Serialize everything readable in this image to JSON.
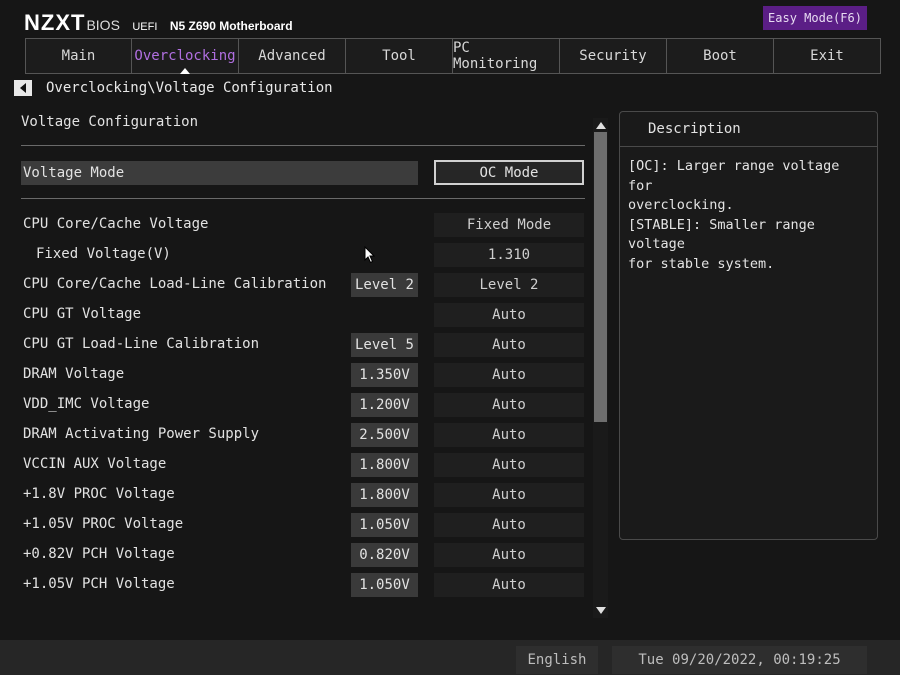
{
  "brand": {
    "logo": "NZXT",
    "bios": "BIOS",
    "uefi": "UEFI",
    "model": "N5 Z690 Motherboard"
  },
  "easy_mode_label": "Easy Mode(F6)",
  "tabs": [
    {
      "label": "Main"
    },
    {
      "label": "Overclocking"
    },
    {
      "label": "Advanced"
    },
    {
      "label": "Tool"
    },
    {
      "label": "PC Monitoring"
    },
    {
      "label": "Security"
    },
    {
      "label": "Boot"
    },
    {
      "label": "Exit"
    }
  ],
  "active_tab": "Overclocking",
  "breadcrumb": "Overclocking\\Voltage Configuration",
  "section_title": "Voltage Configuration",
  "voltage_mode": {
    "label": "Voltage Mode",
    "value": "OC Mode"
  },
  "settings": [
    {
      "label": "CPU Core/Cache Voltage",
      "current": "",
      "value": "Fixed Mode"
    },
    {
      "label": "Fixed Voltage(V)",
      "current": "",
      "value": "1.310"
    },
    {
      "label": "CPU Core/Cache Load-Line Calibration",
      "current": "Level 2",
      "value": "Level 2"
    },
    {
      "label": "CPU GT Voltage",
      "current": "",
      "value": "Auto"
    },
    {
      "label": "CPU GT Load-Line Calibration",
      "current": "Level 5",
      "value": "Auto"
    },
    {
      "label": "DRAM Voltage",
      "current": "1.350V",
      "value": "Auto"
    },
    {
      "label": "VDD_IMC Voltage",
      "current": "1.200V",
      "value": "Auto"
    },
    {
      "label": "DRAM Activating Power Supply",
      "current": "2.500V",
      "value": "Auto"
    },
    {
      "label": "VCCIN AUX Voltage",
      "current": "1.800V",
      "value": "Auto"
    },
    {
      "label": "+1.8V PROC Voltage",
      "current": "1.800V",
      "value": "Auto"
    },
    {
      "label": "+1.05V PROC Voltage",
      "current": "1.050V",
      "value": "Auto"
    },
    {
      "label": "+0.82V PCH Voltage",
      "current": "0.820V",
      "value": "Auto"
    },
    {
      "label": "+1.05V PCH Voltage",
      "current": "1.050V",
      "value": "Auto"
    }
  ],
  "description": {
    "title": "Description",
    "text": "[OC]: Larger range voltage for\noverclocking.\n[STABLE]: Smaller range voltage\nfor stable system."
  },
  "footer": {
    "language": "English",
    "datetime": "Tue 09/20/2022, 00:19:25"
  },
  "colors": {
    "accent": "#5b1e86",
    "active_tab_text": "#b06fe0",
    "background": "#161616"
  }
}
